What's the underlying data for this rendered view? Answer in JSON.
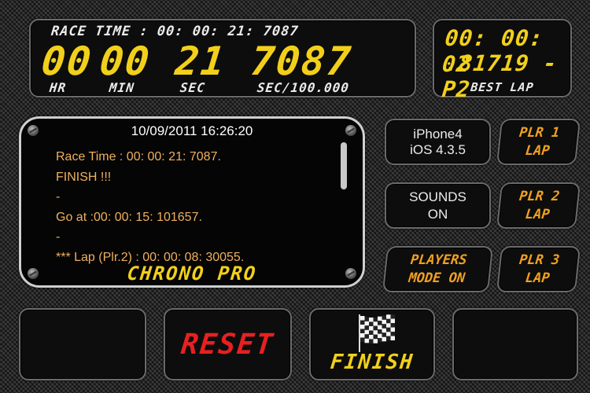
{
  "timer": {
    "race_time_caption": "RACE TIME : 00: 00: 21: 7087",
    "hours": "00",
    "minutes": "00",
    "seconds": "21",
    "hundred_thousandths": "7087",
    "hours_label": "HR",
    "minutes_label": "MIN",
    "seconds_label": "SEC",
    "fraction_label": "SEC/100.000"
  },
  "best_lap": {
    "line1": "00: 00: 02",
    "line2": ".81719 -P2",
    "label": "BEST LAP"
  },
  "log": {
    "timestamp": "10/09/2011 16:26:20",
    "lines": [
      "Race Time : 00: 00: 21: 7087.",
      "FINISH !!!",
      "-",
      "Go at :00: 00: 15: 101657.",
      "-",
      "*** Lap (Plr.2) : 00: 00: 08: 30055."
    ],
    "title": "CHRONO PRO"
  },
  "device_info": {
    "line1": "iPhone4",
    "line2": "iOS 4.3.5"
  },
  "sounds_button": {
    "line1": "SOUNDS",
    "line2": "ON"
  },
  "players_button": {
    "line1": "PLAYERS",
    "line2": "MODE ON"
  },
  "player_lap_buttons": [
    {
      "line1": "PLR 1",
      "line2": "LAP"
    },
    {
      "line1": "PLR 2",
      "line2": "LAP"
    },
    {
      "line1": "PLR 3",
      "line2": "LAP"
    }
  ],
  "reset_button": {
    "label": "RESET"
  },
  "finish_button": {
    "label": "FINISH",
    "icon": "checkered-flag-icon"
  },
  "colors": {
    "digit_yellow": "#f2d01a",
    "accent_orange": "#f0a020",
    "reset_red": "#e82020",
    "log_text": "#f0b060"
  }
}
